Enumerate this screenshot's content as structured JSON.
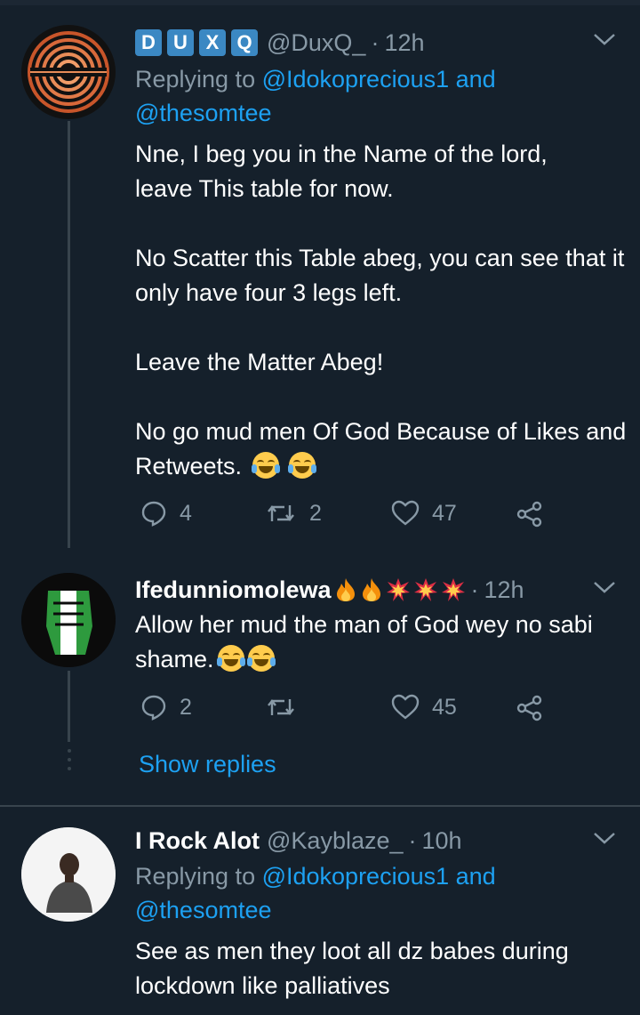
{
  "tweets": [
    {
      "badges": [
        "D",
        "U",
        "X",
        "Q"
      ],
      "handle": "@DuxQ_",
      "time": "12h",
      "reply_prefix": "Replying to ",
      "reply_user1": "@Idokoprecious1",
      "reply_and": " and",
      "reply_user2": "@thesomtee",
      "body": [
        "Nne, I beg you in the Name of the lord, leave This table for now.",
        "No Scatter this Table abeg, you can see that it only have four 3 legs left.",
        "Leave the Matter Abeg!",
        "No go mud men Of God Because of Likes and Retweets."
      ],
      "reply_count": "4",
      "retweet_count": "2",
      "like_count": "47",
      "avatar_icon": "spiral-logo-avatar"
    },
    {
      "name": "Ifedunniomolewa",
      "time": "12h",
      "body": "Allow her mud the man of God wey no sabi shame.",
      "reply_count": "2",
      "retweet_count": "",
      "like_count": "45",
      "show_replies": "Show replies",
      "avatar_icon": "fist-flag-avatar"
    },
    {
      "name": "I Rock Alot",
      "handle": "@Kayblaze_",
      "time": "10h",
      "reply_prefix": "Replying to ",
      "reply_user1": "@Idokoprecious1",
      "reply_and": " and",
      "reply_user2": "@thesomtee",
      "body": "See as men they loot all dz babes during lockdown like palliatives",
      "avatar_icon": "person-photo-avatar"
    }
  ],
  "colors": {
    "background": "#15202b",
    "link": "#1da1f2",
    "muted": "#8899a6",
    "badge": "#3b88c3"
  }
}
